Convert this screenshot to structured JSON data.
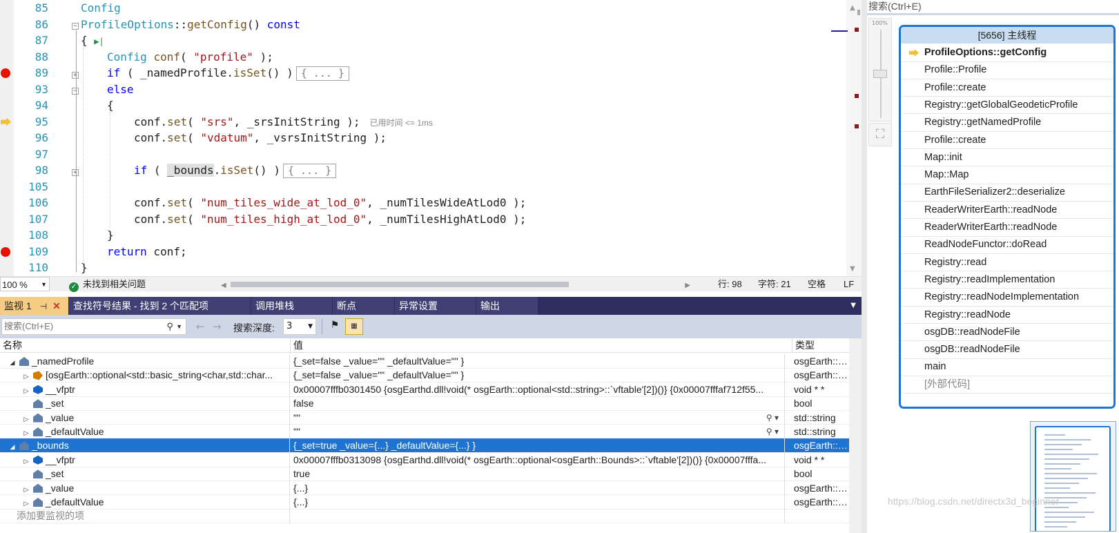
{
  "editor": {
    "lines": [
      {
        "num": "85",
        "bp": false,
        "exec": false
      },
      {
        "num": "86",
        "bp": false,
        "exec": false
      },
      {
        "num": "87",
        "bp": false,
        "exec": false
      },
      {
        "num": "88",
        "bp": false,
        "exec": false
      },
      {
        "num": "89",
        "bp": true,
        "exec": false
      },
      {
        "num": "93",
        "bp": false,
        "exec": false
      },
      {
        "num": "94",
        "bp": false,
        "exec": false
      },
      {
        "num": "95",
        "bp": false,
        "exec": true
      },
      {
        "num": "96",
        "bp": false,
        "exec": false
      },
      {
        "num": "97",
        "bp": false,
        "exec": false
      },
      {
        "num": "98",
        "bp": false,
        "exec": false
      },
      {
        "num": "105",
        "bp": false,
        "exec": false
      },
      {
        "num": "106",
        "bp": false,
        "exec": false
      },
      {
        "num": "107",
        "bp": false,
        "exec": false
      },
      {
        "num": "108",
        "bp": false,
        "exec": false
      },
      {
        "num": "109",
        "bp": true,
        "exec": false
      },
      {
        "num": "110",
        "bp": false,
        "exec": false
      },
      {
        "num": "111",
        "bp": false,
        "exec": false
      }
    ],
    "code": {
      "l85": "Config",
      "l86_class": "ProfileOptions",
      "l86_sep": "::",
      "l86_fn": "getConfig",
      "l86_paren": "()",
      "l86_const": "const",
      "l87": "{",
      "l88_type": "Config",
      "l88_var": "conf",
      "l88_open": "( ",
      "l88_str": "\"profile\"",
      "l88_close": " );",
      "l89_if": "if",
      "l89_open": " ( _namedProfile.",
      "l89_fn": "isSet",
      "l89_close": "() )",
      "l89_collapsed": "{ ... }",
      "l93": "else",
      "l94": "{",
      "l95_obj": "conf.",
      "l95_fn": "set",
      "l95_open": "( ",
      "l95_str": "\"srs\"",
      "l95_rest": ", _srsInitString );",
      "l95_elapsed": "已用时间 <= 1ms",
      "l96_obj": "conf.",
      "l96_fn": "set",
      "l96_open": "( ",
      "l96_str": "\"vdatum\"",
      "l96_rest": ", _vsrsInitString );",
      "l98_if": "if",
      "l98_open": " ( ",
      "l98_var": "_bounds",
      "l98_dot": ".",
      "l98_fn": "isSet",
      "l98_close": "() )",
      "l98_collapsed": "{ ... }",
      "l106_obj": "conf.",
      "l106_fn": "set",
      "l106_open": "( ",
      "l106_str": "\"num_tiles_wide_at_lod_0\"",
      "l106_rest": ", _numTilesWideAtLod0 );",
      "l107_obj": "conf.",
      "l107_fn": "set",
      "l107_open": "( ",
      "l107_str": "\"num_tiles_high_at_lod_0\"",
      "l107_rest": ", _numTilesHighAtLod0 );",
      "l108": "}",
      "l109_kw": "return",
      "l109_rest": " conf;",
      "l110": "}"
    }
  },
  "status": {
    "zoom": "100 %",
    "issues": "未找到相关问题",
    "line": "行: 98",
    "char": "字符: 21",
    "whitespace": "空格",
    "eol": "LF"
  },
  "tabs": [
    {
      "label": "监视 1",
      "active": true
    },
    {
      "label": "查找符号结果 - 找到 2 个匹配项",
      "active": false
    },
    {
      "label": "调用堆栈",
      "active": false
    },
    {
      "label": "断点",
      "active": false
    },
    {
      "label": "异常设置",
      "active": false
    },
    {
      "label": "输出",
      "active": false
    }
  ],
  "watch_toolbar": {
    "search_placeholder": "搜索(Ctrl+E)",
    "depth_label": "搜索深度:",
    "depth_value": "3"
  },
  "watch": {
    "columns": {
      "name": "名称",
      "value": "值",
      "type": "类型"
    },
    "rows": [
      {
        "indent": 0,
        "expander": "open",
        "icon": "field",
        "name": "_namedProfile",
        "value": "{_set=false _value=\"\" _defaultValue=\"\" }",
        "type": "osgEarth::o...",
        "selected": false,
        "magnifier": false
      },
      {
        "indent": 1,
        "expander": "closed",
        "icon": "base",
        "name": "[osgEarth::optional<std::basic_string<char,std::char...",
        "value": "{_set=false _value=\"\" _defaultValue=\"\" }",
        "type": "osgEarth::o...",
        "selected": false,
        "magnifier": false
      },
      {
        "indent": 1,
        "expander": "closed",
        "icon": "vfp",
        "name": "__vfptr",
        "value": "0x00007fffb0301450 {osgEarthd.dll!void(* osgEarth::optional<std::string>::`vftable'[2])()} {0x00007fffaf712f55...",
        "type": "void * *",
        "selected": false,
        "magnifier": false
      },
      {
        "indent": 1,
        "expander": "none",
        "icon": "field",
        "name": "_set",
        "value": "false",
        "type": "bool",
        "selected": false,
        "magnifier": false
      },
      {
        "indent": 1,
        "expander": "closed",
        "icon": "field",
        "name": "_value",
        "value": "\"\"",
        "type": "std::string",
        "selected": false,
        "magnifier": true
      },
      {
        "indent": 1,
        "expander": "closed",
        "icon": "field",
        "name": "_defaultValue",
        "value": "\"\"",
        "type": "std::string",
        "selected": false,
        "magnifier": true
      },
      {
        "indent": 0,
        "expander": "open",
        "icon": "field",
        "name": "_bounds",
        "value": "{_set=true _value={...} _defaultValue={...} }",
        "type": "osgEarth::o...",
        "selected": true,
        "magnifier": false
      },
      {
        "indent": 1,
        "expander": "closed",
        "icon": "vfp",
        "name": "__vfptr",
        "value": "0x00007fffb0313098 {osgEarthd.dll!void(* osgEarth::optional<osgEarth::Bounds>::`vftable'[2])()} {0x00007fffa...",
        "type": "void * *",
        "selected": false,
        "magnifier": false
      },
      {
        "indent": 1,
        "expander": "none",
        "icon": "field",
        "name": "_set",
        "value": "true",
        "type": "bool",
        "selected": false,
        "magnifier": false
      },
      {
        "indent": 1,
        "expander": "closed",
        "icon": "field",
        "name": "_value",
        "value": "{...}",
        "type": "osgEarth::B...",
        "selected": false,
        "magnifier": false
      },
      {
        "indent": 1,
        "expander": "closed",
        "icon": "field",
        "name": "_defaultValue",
        "value": "{...}",
        "type": "osgEarth::B...",
        "selected": false,
        "magnifier": false
      },
      {
        "indent": 0,
        "expander": "none",
        "icon": "none",
        "name": "添加要监视的项",
        "value": "",
        "type": "",
        "selected": false,
        "magnifier": false
      }
    ]
  },
  "right_panel": {
    "search_placeholder": "搜索(Ctrl+E)",
    "zoom_label": "100%",
    "thread_title": "[5656] 主线程",
    "frames": [
      {
        "label": "ProfileOptions::getConfig",
        "current": true,
        "external": false
      },
      {
        "label": "Profile::Profile",
        "current": false,
        "external": false
      },
      {
        "label": "Profile::create",
        "current": false,
        "external": false
      },
      {
        "label": "Registry::getGlobalGeodeticProfile",
        "current": false,
        "external": false
      },
      {
        "label": "Registry::getNamedProfile",
        "current": false,
        "external": false
      },
      {
        "label": "Profile::create",
        "current": false,
        "external": false
      },
      {
        "label": "Map::init",
        "current": false,
        "external": false
      },
      {
        "label": "Map::Map",
        "current": false,
        "external": false
      },
      {
        "label": "EarthFileSerializer2::deserialize",
        "current": false,
        "external": false
      },
      {
        "label": "ReaderWriterEarth::readNode",
        "current": false,
        "external": false
      },
      {
        "label": "ReaderWriterEarth::readNode",
        "current": false,
        "external": false
      },
      {
        "label": "ReadNodeFunctor::doRead",
        "current": false,
        "external": false
      },
      {
        "label": "Registry::read",
        "current": false,
        "external": false
      },
      {
        "label": "Registry::readImplementation",
        "current": false,
        "external": false
      },
      {
        "label": "Registry::readNodeImplementation",
        "current": false,
        "external": false
      },
      {
        "label": "Registry::readNode",
        "current": false,
        "external": false
      },
      {
        "label": "osgDB::readNodeFile",
        "current": false,
        "external": false
      },
      {
        "label": "osgDB::readNodeFile",
        "current": false,
        "external": false
      },
      {
        "label": "main",
        "current": false,
        "external": false
      },
      {
        "label": "[外部代码]",
        "current": false,
        "external": true
      }
    ],
    "watermark": "https://blog.csdn.net/directx3d_beginner"
  },
  "colors": {
    "keyword": "#0000ff",
    "type": "#2b91af",
    "string": "#a31515",
    "breakpoint": "#e51400",
    "selection": "#1e74d2",
    "active_tab": "#f5cc84"
  }
}
